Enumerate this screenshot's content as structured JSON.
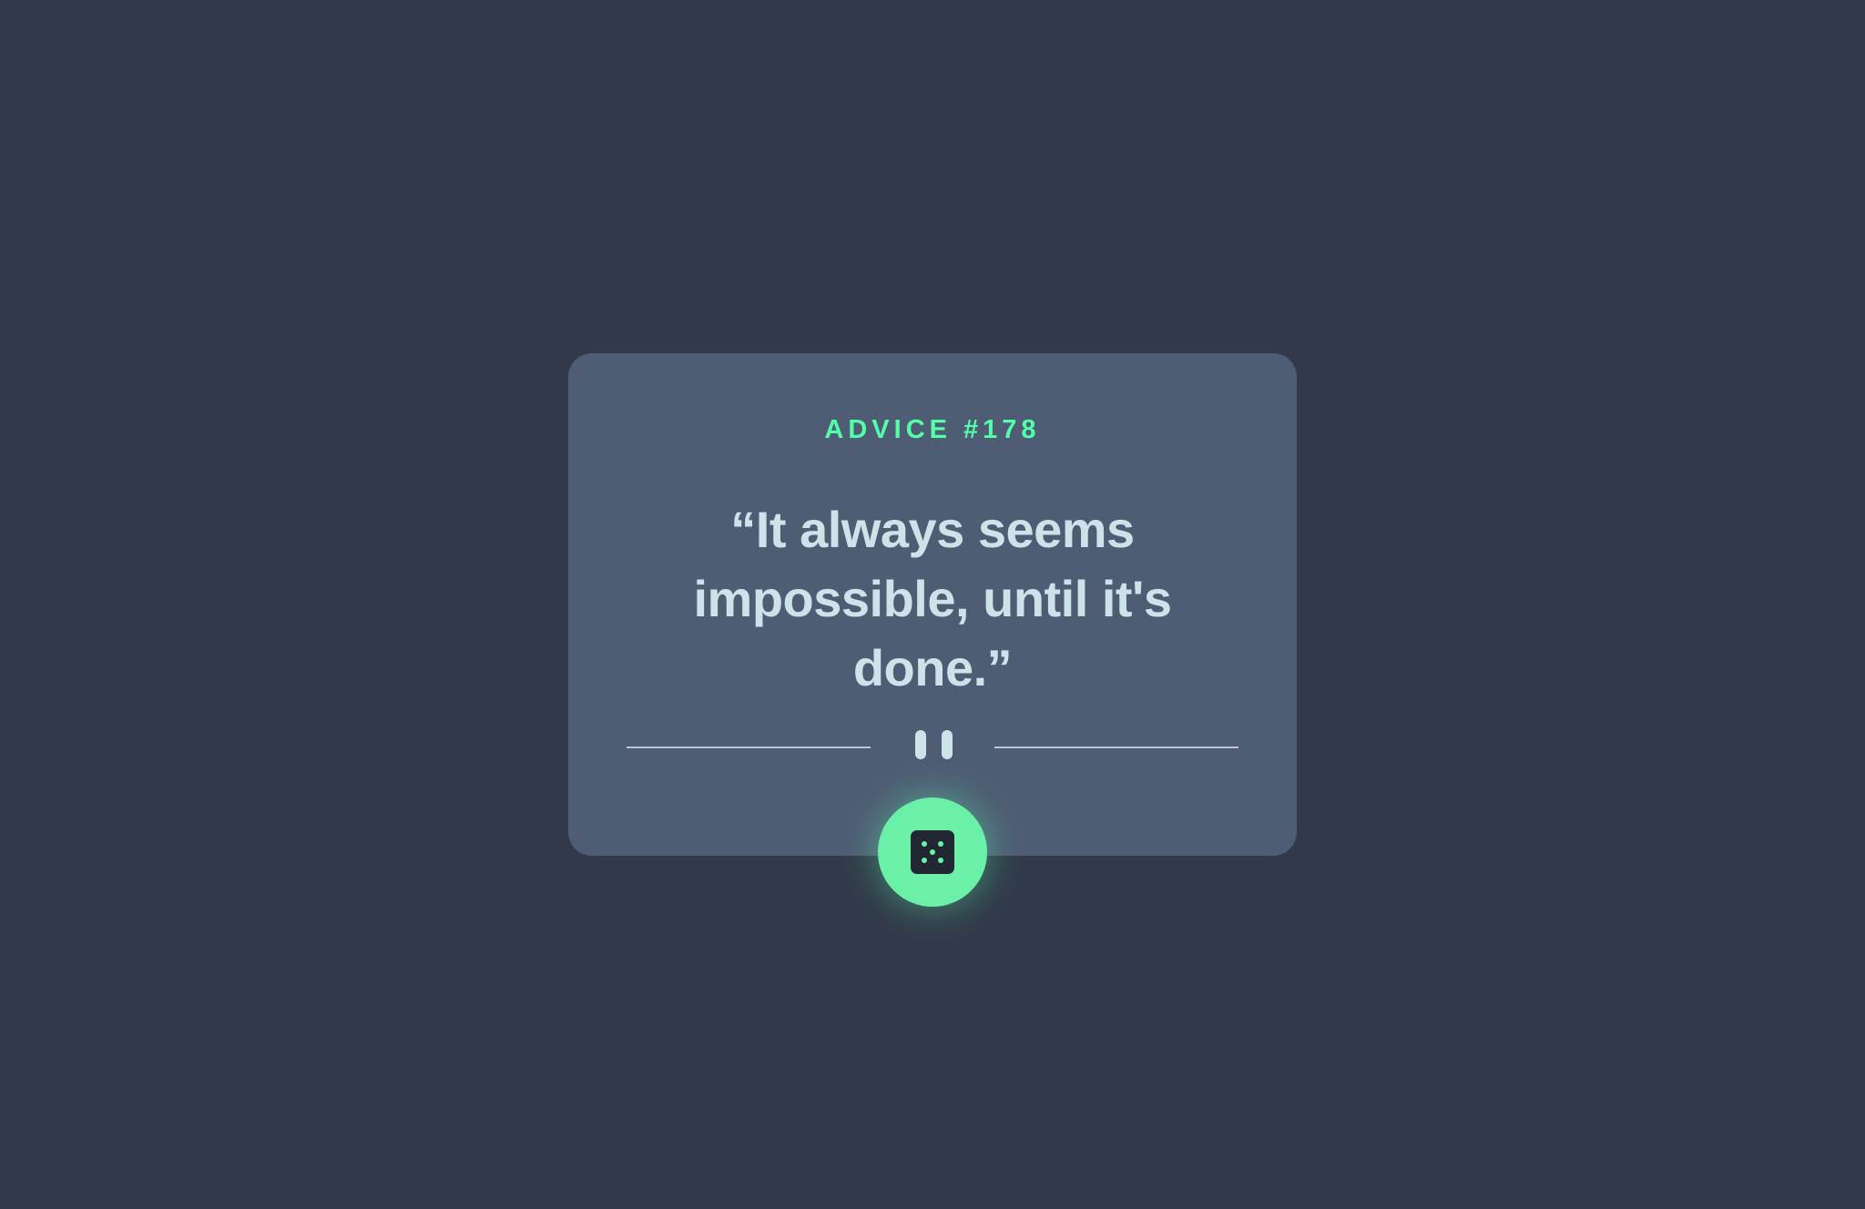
{
  "advice": {
    "heading": "ADVICE #178",
    "quote": "“It always seems impossible, until it's done.”"
  },
  "icons": {
    "divider": "pause-icon",
    "button": "dice-icon"
  },
  "colors": {
    "background": "#323a4a",
    "card": "#4f5d74",
    "accent": "#52ffa8",
    "text": "#cee3e9",
    "dice_face": "#202733"
  }
}
